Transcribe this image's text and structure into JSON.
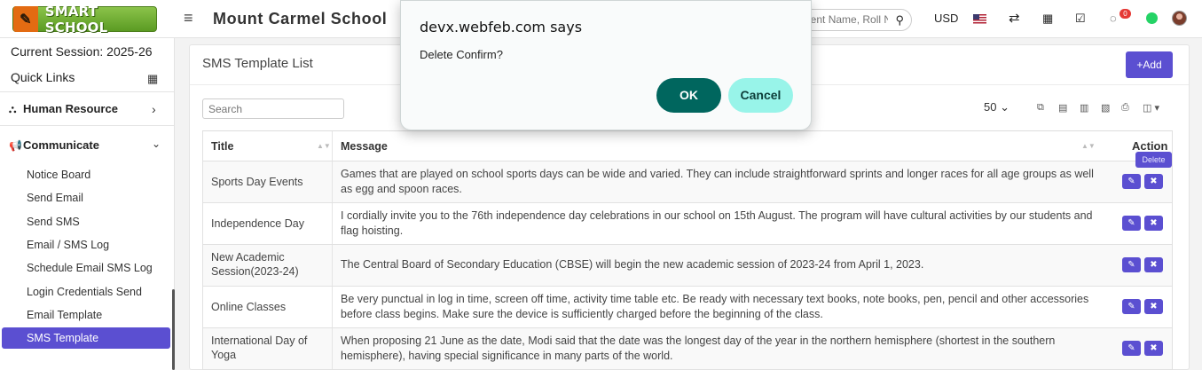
{
  "header": {
    "logo_text": "SMART SCHOOL",
    "school_name": "Mount Carmel School",
    "search_placeholder": "Student Name, Roll Number",
    "currency": "USD",
    "notification_count": "0"
  },
  "sidebar": {
    "session": "Current Session: 2025-26",
    "quick_links": "Quick Links",
    "human_resource": "Human Resource",
    "communicate": "Communicate",
    "items": [
      {
        "label": "Notice Board"
      },
      {
        "label": "Send Email"
      },
      {
        "label": "Send SMS"
      },
      {
        "label": "Email / SMS Log"
      },
      {
        "label": "Schedule Email SMS Log"
      },
      {
        "label": "Login Credentials Send"
      },
      {
        "label": "Email Template"
      },
      {
        "label": "SMS Template"
      }
    ]
  },
  "panel": {
    "title": "SMS Template List",
    "add_label": "Add",
    "search_placeholder": "Search",
    "page_size": "50",
    "columns": {
      "title": "Title",
      "message": "Message",
      "action": "Action"
    },
    "delete_tooltip": "Delete",
    "rows": [
      {
        "title": "Sports Day Events",
        "message": "Games that are played on school sports days can be wide and varied. They can include straightforward sprints and longer races for all age groups as well as egg and spoon races."
      },
      {
        "title": "Independence Day",
        "message": "I cordially invite you to the 76th independence day celebrations in our school on 15th August. The program will have cultural activities by our students and flag hoisting."
      },
      {
        "title": "New Academic Session(2023-24)",
        "message": "The Central Board of Secondary Education (CBSE) will begin the new academic session of 2023-24 from April 1, 2023."
      },
      {
        "title": "Online Classes",
        "message": "Be very punctual in log in time, screen off time, activity time table etc. Be ready with necessary text books, note books, pen, pencil and other accessories before class begins. Make sure the device is sufficiently charged before the beginning of the class."
      },
      {
        "title": "International Day of Yoga",
        "message": "When proposing 21 June as the date, Modi said that the date was the longest day of the year in the northern hemisphere (shortest in the southern hemisphere), having special significance in many parts of the world."
      }
    ]
  },
  "dialog": {
    "title": "devx.webfeb.com says",
    "message": "Delete Confirm?",
    "ok_label": "OK",
    "cancel_label": "Cancel"
  }
}
